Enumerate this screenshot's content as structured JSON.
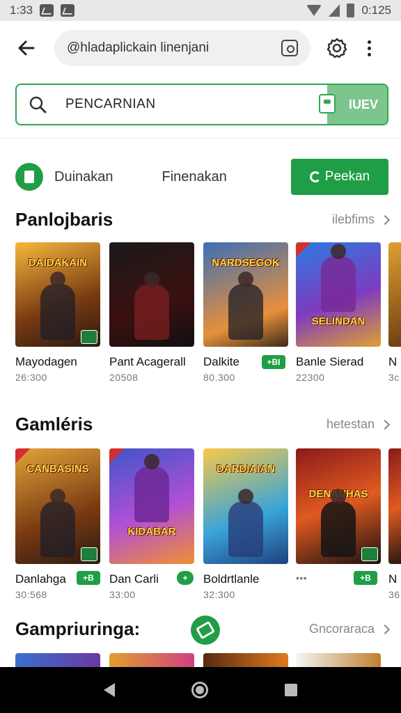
{
  "status_bar": {
    "time": "1:33",
    "right_text": "0:125"
  },
  "browser": {
    "url": "@hladaplickain linenjani"
  },
  "search": {
    "value": "PENCARNIAN",
    "placeholder": "",
    "action_label": "IUEV"
  },
  "filters": {
    "items": [
      "Duinakan",
      "Finenakan"
    ],
    "button_label": "Peekan"
  },
  "sections": [
    {
      "title": "Panlojbaris",
      "more_label": "ilebfims",
      "cards": [
        {
          "thumb_text": "DAIDAKAIN",
          "name": "Mayodagen",
          "meta": "26:300"
        },
        {
          "thumb_text": "",
          "name": "Pant Acagerall",
          "meta": "20508"
        },
        {
          "thumb_text": "NARDSEGOK",
          "name": "Dalkite",
          "meta": "80.300",
          "badge": "+BI"
        },
        {
          "thumb_text": "SELINDAN",
          "name": "Banle Sierad",
          "meta": "22300"
        },
        {
          "thumb_text": "",
          "name": "N",
          "meta": "3c"
        }
      ]
    },
    {
      "title": "Gamléris",
      "more_label": "hetestan",
      "cards": [
        {
          "thumb_text": "CANBASINS",
          "name": "Danlahga",
          "meta": "30:568",
          "badge": "+B"
        },
        {
          "thumb_text": "KIDABAR",
          "name": "Dan Carli",
          "meta": "33:00",
          "badge": "+"
        },
        {
          "thumb_text": "DARDIAIAN",
          "name": "Boldrtlanle",
          "meta": "32:300"
        },
        {
          "thumb_text": "DENANHAS",
          "name": "",
          "meta": "•••",
          "badge": "+B"
        },
        {
          "thumb_text": "",
          "name": "N",
          "meta": "36"
        }
      ]
    },
    {
      "title": "Gampriuringa:",
      "more_label": "Gncoraraca"
    }
  ],
  "icons": {
    "back": "arrow-left-icon",
    "camera": "camera-icon",
    "settings": "gear-icon",
    "more": "more-vertical-icon",
    "search": "search-icon",
    "bag": "shopping-bag-icon",
    "filter": "document-icon",
    "float": "tag-icon"
  },
  "colors": {
    "accent": "#1f9e46",
    "accent_light": "#7cc58f",
    "status_bg": "#e8e8e8",
    "nav_bg": "#000000"
  }
}
